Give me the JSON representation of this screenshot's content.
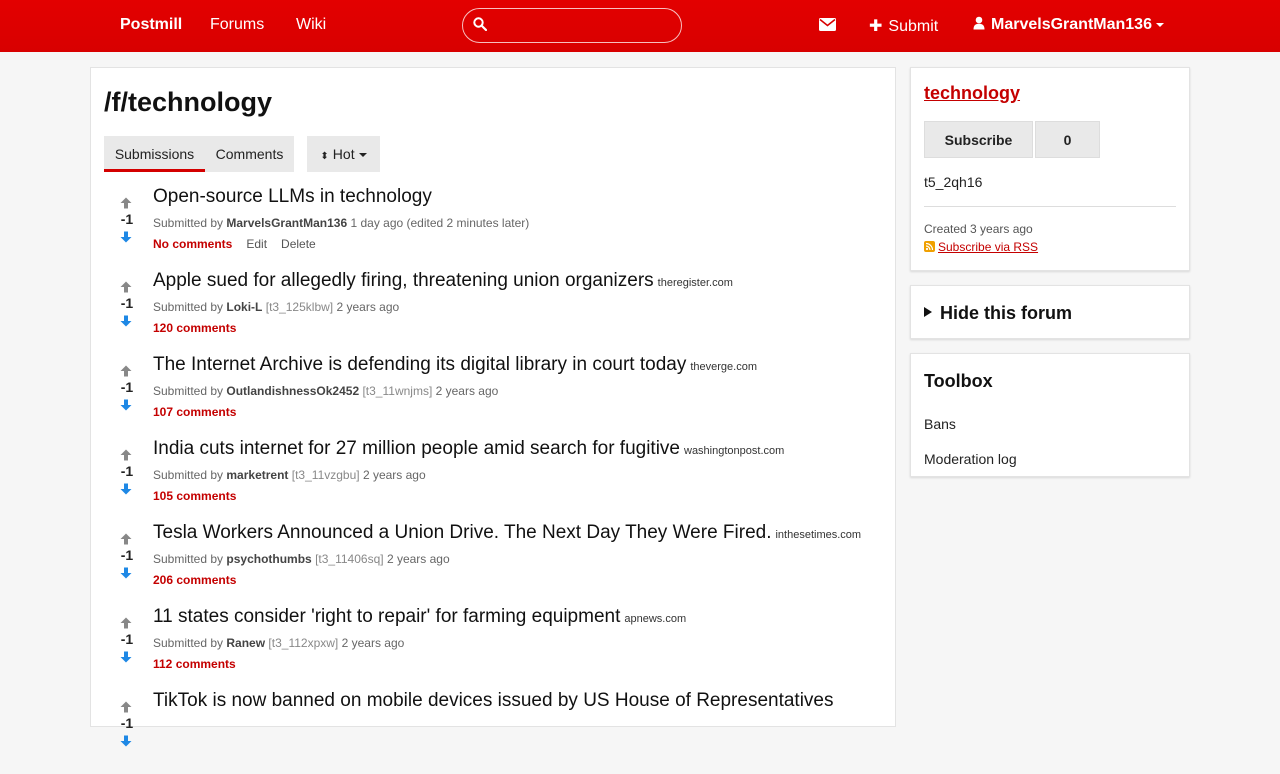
{
  "nav": {
    "brand": "Postmill",
    "forums": "Forums",
    "wiki": "Wiki",
    "search_placeholder": "",
    "submit": "Submit",
    "username": "MarvelsGrantMan136"
  },
  "page": {
    "title": "/f/technology",
    "tabs": [
      "Submissions",
      "Comments"
    ],
    "sort": "Hot"
  },
  "posts": [
    {
      "title": "Open-source LLMs in technology",
      "domain": "",
      "submitted_by": "Submitted by",
      "author": "MarvelsGrantMan136",
      "tid": "",
      "time": "1 day ago (edited 2 minutes later)",
      "score": "-1",
      "comments": "No comments",
      "edit": "Edit",
      "delete": "Delete"
    },
    {
      "title": "Apple sued for allegedly firing, threatening union organizers",
      "domain": "theregister.com",
      "submitted_by": "Submitted by",
      "author": "Loki-L",
      "tid": "[t3_125klbw]",
      "time": "2 years ago",
      "score": "-1",
      "comments": "120 comments"
    },
    {
      "title": "The Internet Archive is defending its digital library in court today",
      "domain": "theverge.com",
      "submitted_by": "Submitted by",
      "author": "OutlandishnessOk2452",
      "tid": "[t3_11wnjms]",
      "time": "2 years ago",
      "score": "-1",
      "comments": "107 comments"
    },
    {
      "title": "India cuts internet for 27 million people amid search for fugitive",
      "domain": "washingtonpost.com",
      "submitted_by": "Submitted by",
      "author": "marketrent",
      "tid": "[t3_11vzgbu]",
      "time": "2 years ago",
      "score": "-1",
      "comments": "105 comments"
    },
    {
      "title": "Tesla Workers Announced a Union Drive. The Next Day They Were Fired.",
      "domain": "inthesetimes.com",
      "submitted_by": "Submitted by",
      "author": "psychothumbs",
      "tid": "[t3_11406sq]",
      "time": "2 years ago",
      "score": "-1",
      "comments": "206 comments"
    },
    {
      "title": "11 states consider 'right to repair' for farming equipment",
      "domain": "apnews.com",
      "submitted_by": "Submitted by",
      "author": "Ranew",
      "tid": "[t3_112xpxw]",
      "time": "2 years ago",
      "score": "-1",
      "comments": "112 comments"
    },
    {
      "title": "TikTok is now banned on mobile devices issued by US House of Representatives",
      "domain": "",
      "submitted_by": "",
      "author": "",
      "tid": "",
      "time": "",
      "score": "-1",
      "comments": ""
    }
  ],
  "sidebar": {
    "forum_name": "technology",
    "subscribe": "Subscribe",
    "subscriber_count": "0",
    "forum_id": "t5_2qh16",
    "created": "Created 3 years ago",
    "rss": "Subscribe via RSS",
    "hide_forum": "Hide this forum",
    "toolbox_title": "Toolbox",
    "toolbox_links": [
      "Bans",
      "Moderation log"
    ]
  },
  "colors": {
    "accent": "#d40000",
    "vote_up": "#888888",
    "vote_down": "#1e88e5"
  }
}
